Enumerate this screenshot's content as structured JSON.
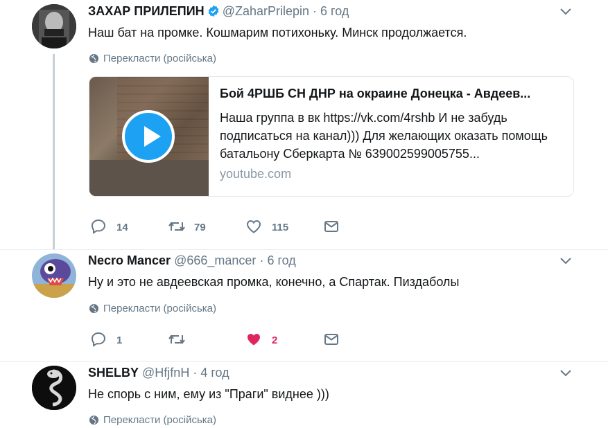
{
  "tweets": [
    {
      "name": "ЗАХАР ПРИЛЕПИН",
      "handle": "@ZaharPrilepin",
      "sep": "·",
      "time": "6 год",
      "text": "Наш бат на промке. Кошмарим потихоньку. Минск продолжается.",
      "translate": "Перекласти (російська)",
      "card": {
        "title": "Бой 4РШБ СН ДНР на окраине Донецка - Авдеев...",
        "desc": "Наша группа в вк https://vk.com/4rshb И не забудь подписаться на канал))) Для желающих оказать помощь батальону Сберкарта № 639002599005755...",
        "domain": "youtube.com"
      },
      "actions": {
        "reply": "14",
        "retweet": "79",
        "like": "115"
      }
    },
    {
      "name": "Necro Mancer",
      "handle": "@666_mancer",
      "sep": "·",
      "time": "6 год",
      "text": "Ну и это не авдеевская промка, конечно, а Спартак. Пиздаболы",
      "translate": "Перекласти (російська)",
      "actions": {
        "reply": "1",
        "retweet": "",
        "like": "2"
      }
    },
    {
      "name": "SHELBY",
      "handle": "@HfjfnH",
      "sep": "·",
      "time": "4 год",
      "text": "Не спорь с ним, ему из \"Праги\" виднее )))",
      "translate": "Перекласти (російська)"
    }
  ],
  "icons": [
    "verified-icon",
    "chevron-down-icon",
    "globe-icon",
    "reply-icon",
    "retweet-icon",
    "like-icon",
    "mail-icon",
    "play-icon"
  ],
  "colors": {
    "accent": "#1da1f2",
    "like_active": "#e0245e",
    "muted": "#657786"
  }
}
